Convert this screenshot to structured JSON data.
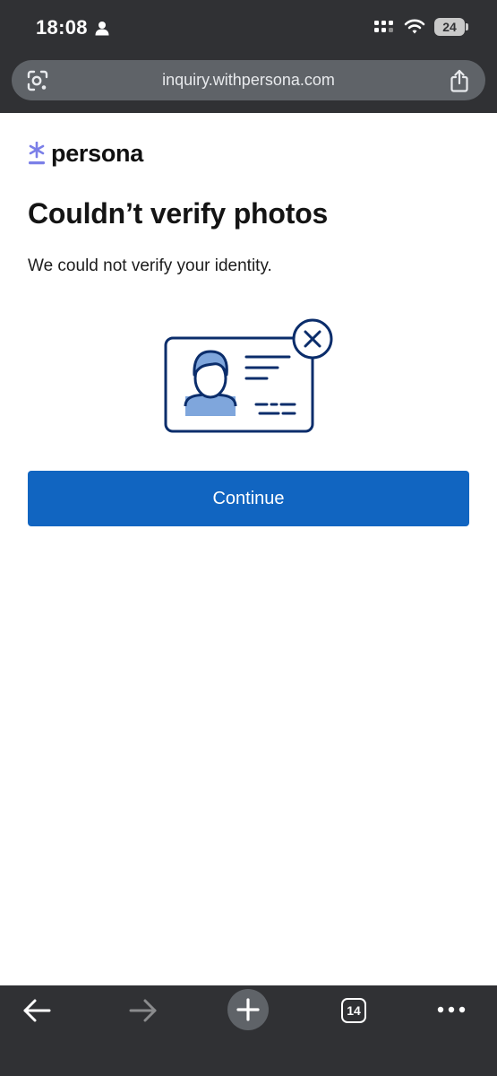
{
  "status_bar": {
    "time": "18:08",
    "battery_level": "24"
  },
  "browser": {
    "url": "inquiry.withpersona.com",
    "tab_count": "14"
  },
  "brand": {
    "name": "persona",
    "accent_color": "#7b7fe8"
  },
  "page": {
    "title": "Couldn’t verify photos",
    "message": "We could not verify your identity.",
    "continue_label": "Continue",
    "button_color": "#1165c1"
  },
  "icons": {
    "status": [
      "person-icon",
      "signal-icon",
      "wifi-icon",
      "battery-icon"
    ],
    "url_bar": [
      "lens-icon",
      "share-icon"
    ],
    "toolbar": [
      "back-arrow-icon",
      "forward-arrow-icon",
      "new-tab-plus-icon",
      "tab-switcher-icon",
      "more-menu-icon"
    ]
  }
}
